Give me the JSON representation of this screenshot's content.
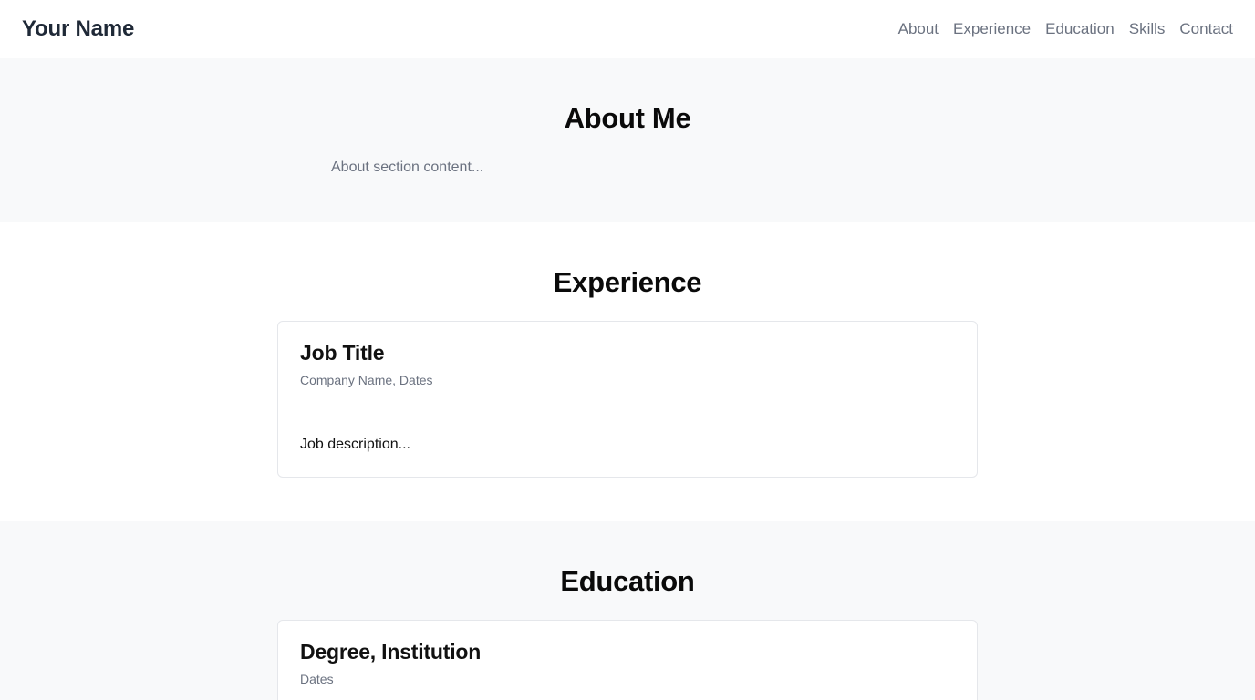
{
  "header": {
    "brand": "Your Name",
    "nav": [
      {
        "label": "About"
      },
      {
        "label": "Experience"
      },
      {
        "label": "Education"
      },
      {
        "label": "Skills"
      },
      {
        "label": "Contact"
      }
    ]
  },
  "about": {
    "title": "About Me",
    "content": "About section content..."
  },
  "experience": {
    "title": "Experience",
    "job": {
      "title": "Job Title",
      "subtitle": "Company Name, Dates",
      "description": "Job description..."
    }
  },
  "education": {
    "title": "Education",
    "entry": {
      "title": "Degree, Institution",
      "subtitle": "Dates"
    }
  },
  "colors": {
    "section_gray": "#f8f9fa",
    "muted_text": "#6b7280",
    "brand_text": "#1f2937",
    "card_border": "#e5e7eb"
  }
}
